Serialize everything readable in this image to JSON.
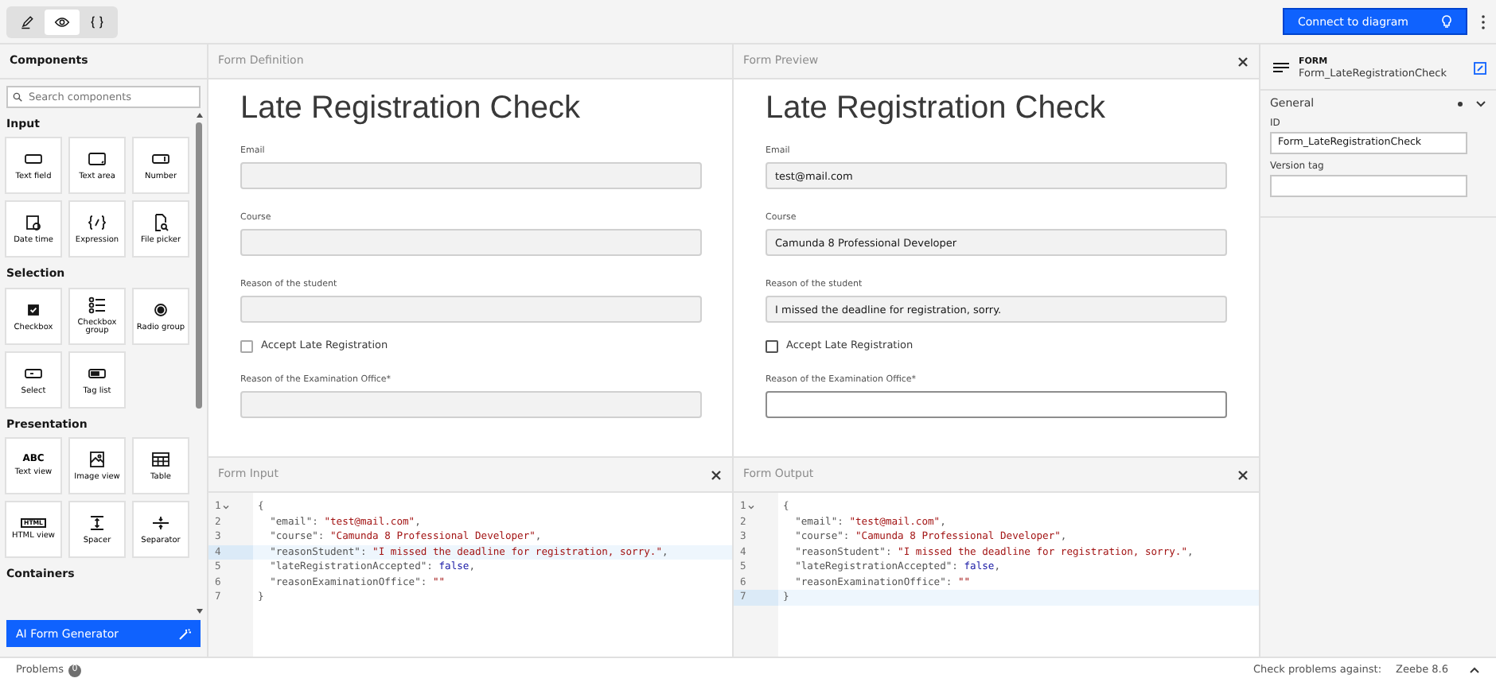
{
  "toolbar": {
    "modes": [
      {
        "kind": "edit",
        "selected": false
      },
      {
        "kind": "preview",
        "selected": true
      },
      {
        "kind": "code",
        "selected": false
      }
    ],
    "primary_button": "Connect to diagram"
  },
  "sidebar": {
    "title": "Components",
    "search": {
      "placeholder": "Search components"
    },
    "groups": [
      {
        "title": "Input",
        "items": [
          {
            "label": "Text field",
            "kind": "textfield"
          },
          {
            "label": "Text area",
            "kind": "textarea"
          },
          {
            "label": "Number",
            "kind": "number"
          },
          {
            "label": "Date time",
            "kind": "datetime"
          },
          {
            "label": "Expression",
            "kind": "expression"
          },
          {
            "label": "File picker",
            "kind": "file"
          }
        ]
      },
      {
        "title": "Selection",
        "items": [
          {
            "label": "Checkbox",
            "kind": "checkbox"
          },
          {
            "label": "Checkbox group",
            "kind": "checklist"
          },
          {
            "label": "Radio group",
            "kind": "radio"
          },
          {
            "label": "Select",
            "kind": "select"
          },
          {
            "label": "Tag list",
            "kind": "taglist"
          }
        ]
      },
      {
        "title": "Presentation",
        "items": [
          {
            "label": "Text view",
            "kind": "textview",
            "glyph": "ABC"
          },
          {
            "label": "Image view",
            "kind": "image"
          },
          {
            "label": "Table",
            "kind": "table"
          },
          {
            "label": "HTML view",
            "kind": "htmlview",
            "glyph": "HTML"
          },
          {
            "label": "Spacer",
            "kind": "spacer"
          },
          {
            "label": "Separator",
            "kind": "separator"
          }
        ]
      },
      {
        "title": "Containers"
      }
    ],
    "ai_button": "AI Form Generator"
  },
  "definition": {
    "title": "Form Definition",
    "heading": "Late Registration Check",
    "fields": [
      {
        "kind": "text",
        "label": "Email",
        "disabled": true
      },
      {
        "kind": "text",
        "label": "Course",
        "disabled": true
      },
      {
        "kind": "text",
        "label": "Reason of the student",
        "disabled": true
      },
      {
        "kind": "checkbox",
        "label": "Accept Late Registration",
        "checked": false,
        "disabled": true
      },
      {
        "kind": "text",
        "label": "Reason of the Examination Office*",
        "disabled": true
      }
    ]
  },
  "preview": {
    "title": "Form Preview",
    "heading": "Late Registration Check",
    "fields": [
      {
        "kind": "text",
        "label": "Email",
        "value": "test@mail.com",
        "disabled": true
      },
      {
        "kind": "text",
        "label": "Course",
        "value": "Camunda 8 Professional Developer",
        "disabled": true
      },
      {
        "kind": "text",
        "label": "Reason of the student",
        "value": "I missed the deadline for registration, sorry.",
        "disabled": true
      },
      {
        "kind": "checkbox",
        "label": "Accept Late Registration",
        "checked": false,
        "disabled": false
      },
      {
        "kind": "text",
        "label": "Reason of the Examination Office*",
        "disabled": false
      }
    ]
  },
  "input": {
    "title": "Form Input",
    "lines": [
      {
        "number": "1",
        "foldable": true,
        "active": false,
        "tokens": [
          {
            "kind": "punct",
            "text": "{"
          }
        ]
      },
      {
        "number": "2",
        "foldable": false,
        "active": false,
        "tokens": [
          {
            "kind": "key",
            "text": "  \"email\""
          },
          {
            "kind": "punct",
            "text": ": "
          },
          {
            "kind": "string",
            "text": "\"test@mail.com\""
          },
          {
            "kind": "punct",
            "text": ","
          }
        ]
      },
      {
        "number": "3",
        "foldable": false,
        "active": false,
        "tokens": [
          {
            "kind": "key",
            "text": "  \"course\""
          },
          {
            "kind": "punct",
            "text": ": "
          },
          {
            "kind": "string",
            "text": "\"Camunda 8 Professional Developer\""
          },
          {
            "kind": "punct",
            "text": ","
          }
        ]
      },
      {
        "number": "4",
        "foldable": false,
        "active": true,
        "tokens": [
          {
            "kind": "key",
            "text": "  \"reasonStudent\""
          },
          {
            "kind": "punct",
            "text": ": "
          },
          {
            "kind": "string",
            "text": "\"I missed the deadline for registration, sorry.\""
          },
          {
            "kind": "punct",
            "text": ","
          }
        ]
      },
      {
        "number": "5",
        "foldable": false,
        "active": false,
        "tokens": [
          {
            "kind": "key",
            "text": "  \"lateRegistrationAccepted\""
          },
          {
            "kind": "punct",
            "text": ": "
          },
          {
            "kind": "bool",
            "text": "false"
          },
          {
            "kind": "punct",
            "text": ","
          }
        ]
      },
      {
        "number": "6",
        "foldable": false,
        "active": false,
        "tokens": [
          {
            "kind": "key",
            "text": "  \"reasonExaminationOffice\""
          },
          {
            "kind": "punct",
            "text": ": "
          },
          {
            "kind": "string",
            "text": "\"\""
          }
        ]
      },
      {
        "number": "7",
        "foldable": false,
        "active": false,
        "tokens": [
          {
            "kind": "punct",
            "text": "}"
          }
        ]
      }
    ]
  },
  "output": {
    "title": "Form Output",
    "lines": [
      {
        "number": "1",
        "foldable": true,
        "active": false,
        "tokens": [
          {
            "kind": "punct",
            "text": "{"
          }
        ]
      },
      {
        "number": "2",
        "foldable": false,
        "active": false,
        "tokens": [
          {
            "kind": "key",
            "text": "  \"email\""
          },
          {
            "kind": "punct",
            "text": ": "
          },
          {
            "kind": "string",
            "text": "\"test@mail.com\""
          },
          {
            "kind": "punct",
            "text": ","
          }
        ]
      },
      {
        "number": "3",
        "foldable": false,
        "active": false,
        "tokens": [
          {
            "kind": "key",
            "text": "  \"course\""
          },
          {
            "kind": "punct",
            "text": ": "
          },
          {
            "kind": "string",
            "text": "\"Camunda 8 Professional Developer\""
          },
          {
            "kind": "punct",
            "text": ","
          }
        ]
      },
      {
        "number": "4",
        "foldable": false,
        "active": false,
        "tokens": [
          {
            "kind": "key",
            "text": "  \"reasonStudent\""
          },
          {
            "kind": "punct",
            "text": ": "
          },
          {
            "kind": "string",
            "text": "\"I missed the deadline for registration, sorry.\""
          },
          {
            "kind": "punct",
            "text": ","
          }
        ]
      },
      {
        "number": "5",
        "foldable": false,
        "active": false,
        "tokens": [
          {
            "kind": "key",
            "text": "  \"lateRegistrationAccepted\""
          },
          {
            "kind": "punct",
            "text": ": "
          },
          {
            "kind": "bool",
            "text": "false"
          },
          {
            "kind": "punct",
            "text": ","
          }
        ]
      },
      {
        "number": "6",
        "foldable": false,
        "active": false,
        "tokens": [
          {
            "kind": "key",
            "text": "  \"reasonExaminationOffice\""
          },
          {
            "kind": "punct",
            "text": ": "
          },
          {
            "kind": "string",
            "text": "\"\""
          }
        ]
      },
      {
        "number": "7",
        "foldable": false,
        "active": true,
        "tokens": [
          {
            "kind": "punct",
            "text": "}"
          }
        ]
      }
    ]
  },
  "properties": {
    "type": "FORM",
    "name": "Form_LateRegistrationCheck",
    "section": "General",
    "fields": [
      {
        "label": "ID",
        "value": "Form_LateRegistrationCheck"
      },
      {
        "label": "Version tag"
      }
    ]
  },
  "status_bar": {
    "problems": "Problems",
    "problem_count": "0",
    "check_label": "Check problems against:",
    "engine": "Zeebe 8.6"
  }
}
